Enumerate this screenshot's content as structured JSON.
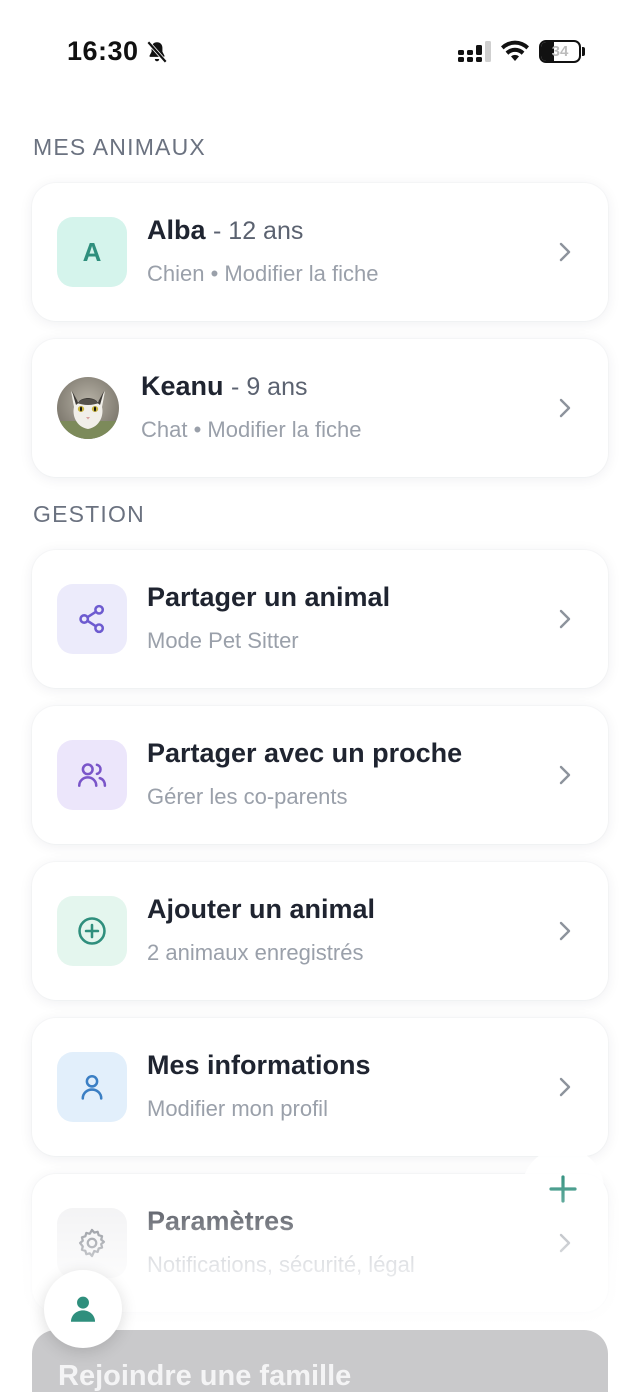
{
  "status_bar": {
    "time": "16:30",
    "battery_level": "34"
  },
  "sections": {
    "animals_title": "MES ANIMAUX",
    "management_title": "GESTION"
  },
  "animals": [
    {
      "name": "Alba",
      "age": "- 12 ans",
      "subtitle": "Chien • Modifier la fiche",
      "avatar_letter": "A"
    },
    {
      "name": "Keanu",
      "age": "- 9 ans",
      "subtitle": "Chat • Modifier la fiche"
    }
  ],
  "menu": [
    {
      "title": "Partager un animal",
      "subtitle": "Mode Pet Sitter",
      "icon": "share-icon"
    },
    {
      "title": "Partager avec un proche",
      "subtitle": "Gérer les co-parents",
      "icon": "users-icon"
    },
    {
      "title": "Ajouter un animal",
      "subtitle": "2 animaux enregistrés",
      "icon": "plus-circle-icon"
    },
    {
      "title": "Mes informations",
      "subtitle": "Modifier mon profil",
      "icon": "user-icon"
    },
    {
      "title": "Paramètres",
      "subtitle": "Notifications, sécurité, légal",
      "icon": "gear-icon"
    }
  ],
  "join_button": {
    "label": "Rejoindre une famille"
  },
  "colors": {
    "accent_green": "#2f8f7d",
    "purple": "#6d5bd0",
    "blue": "#3b7fc4"
  }
}
